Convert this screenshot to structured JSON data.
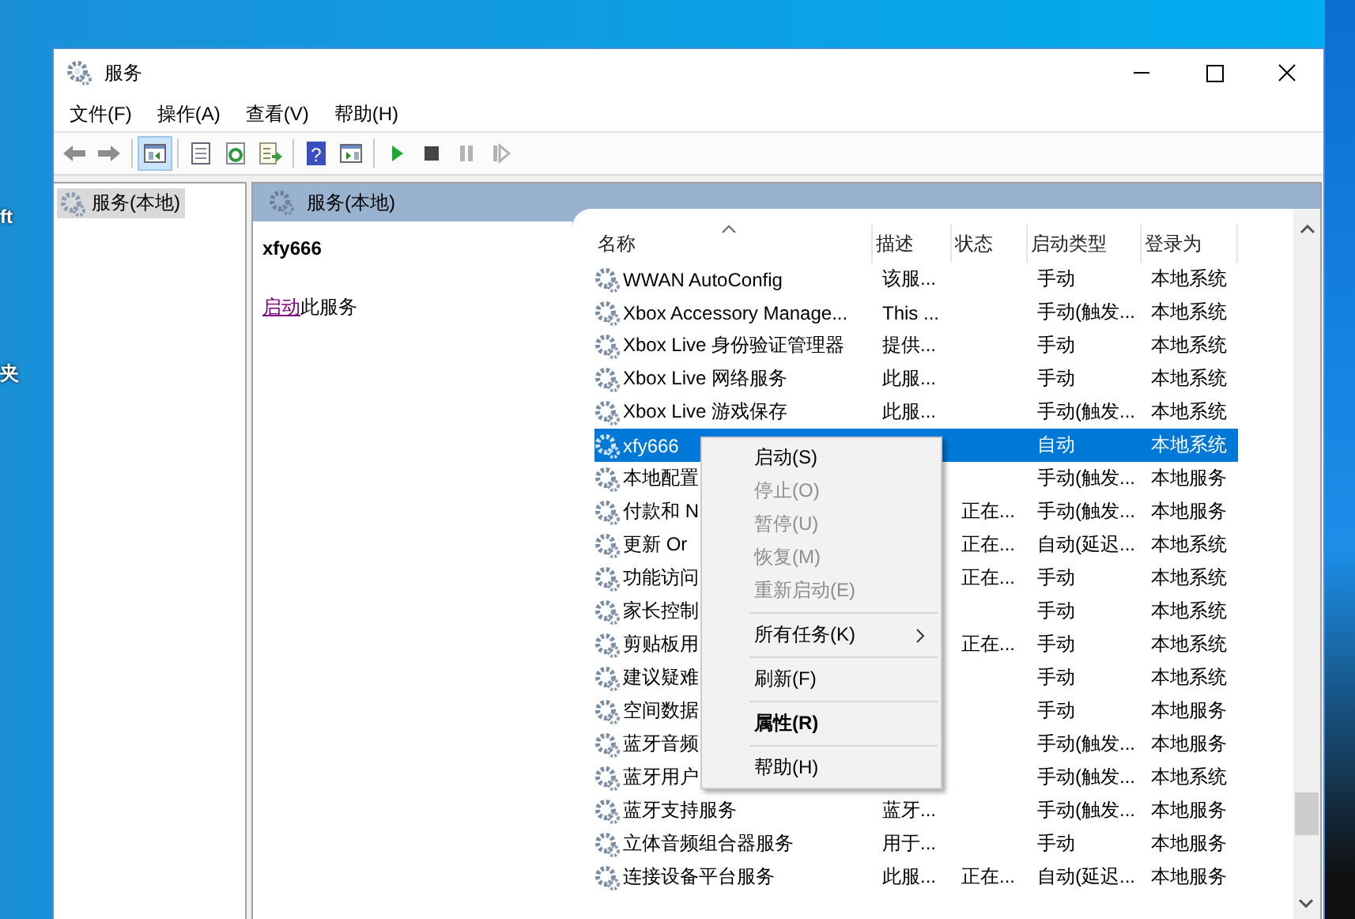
{
  "desktop": {
    "labels": [
      "ft",
      "夹"
    ]
  },
  "window": {
    "title": "服务"
  },
  "menu": [
    "文件(F)",
    "操作(A)",
    "查看(V)",
    "帮助(H)"
  ],
  "toolbar": [
    {
      "kind": "back",
      "disabled": false,
      "pressed": false
    },
    {
      "kind": "forward",
      "disabled": false,
      "pressed": false
    },
    {
      "kind": "sep"
    },
    {
      "kind": "tree",
      "disabled": false,
      "pressed": true
    },
    {
      "kind": "sep"
    },
    {
      "kind": "properties",
      "disabled": false,
      "pressed": false
    },
    {
      "kind": "refresh",
      "disabled": false,
      "pressed": false
    },
    {
      "kind": "export",
      "disabled": false,
      "pressed": false
    },
    {
      "kind": "sep"
    },
    {
      "kind": "help",
      "label": "?",
      "disabled": false,
      "pressed": false
    },
    {
      "kind": "pane",
      "disabled": false,
      "pressed": false
    },
    {
      "kind": "sep"
    },
    {
      "kind": "play",
      "disabled": false,
      "pressed": false
    },
    {
      "kind": "stop",
      "disabled": false,
      "pressed": false
    },
    {
      "kind": "pause",
      "disabled": true,
      "pressed": false
    },
    {
      "kind": "restart",
      "disabled": true,
      "pressed": false
    }
  ],
  "tree": [
    {
      "label": "服务(本地)",
      "selected": true
    }
  ],
  "pane_header": "服务(本地)",
  "detail": {
    "name": "xfy666",
    "link": "启动",
    "text": "此服务"
  },
  "table": {
    "columns": [
      "名称",
      "描述",
      "状态",
      "启动类型",
      "登录为"
    ],
    "rows": [
      {
        "name": "WWAN AutoConfig",
        "desc": "该服...",
        "status": "",
        "startup": "手动",
        "logon": "本地系统",
        "selected": false
      },
      {
        "name": "Xbox Accessory Manage...",
        "desc": "This ...",
        "status": "",
        "startup": "手动(触发...",
        "logon": "本地系统",
        "selected": false
      },
      {
        "name": "Xbox Live 身份验证管理器",
        "desc": "提供...",
        "status": "",
        "startup": "手动",
        "logon": "本地系统",
        "selected": false
      },
      {
        "name": "Xbox Live 网络服务",
        "desc": "此服...",
        "status": "",
        "startup": "手动",
        "logon": "本地系统",
        "selected": false
      },
      {
        "name": "Xbox Live 游戏保存",
        "desc": "此服...",
        "status": "",
        "startup": "手动(触发...",
        "logon": "本地系统",
        "selected": false
      },
      {
        "name": "xfy666",
        "desc": "",
        "status": "",
        "startup": "自动",
        "logon": "本地系统",
        "selected": true
      },
      {
        "name": "本地配置",
        "desc": "",
        "status": "",
        "startup": "手动(触发...",
        "logon": "本地服务",
        "selected": false
      },
      {
        "name": "付款和 N",
        "desc": "",
        "status": "正在...",
        "startup": "手动(触发...",
        "logon": "本地服务",
        "selected": false
      },
      {
        "name": "更新 Or",
        "desc": "",
        "status": "正在...",
        "startup": "自动(延迟...",
        "logon": "本地系统",
        "selected": false
      },
      {
        "name": "功能访问",
        "desc": "",
        "status": "正在...",
        "startup": "手动",
        "logon": "本地系统",
        "selected": false
      },
      {
        "name": "家长控制",
        "desc": "",
        "status": "",
        "startup": "手动",
        "logon": "本地系统",
        "selected": false
      },
      {
        "name": "剪贴板用",
        "desc": "",
        "status": "正在...",
        "startup": "手动",
        "logon": "本地系统",
        "selected": false
      },
      {
        "name": "建议疑难",
        "desc": "",
        "status": "",
        "startup": "手动",
        "logon": "本地系统",
        "selected": false
      },
      {
        "name": "空间数据",
        "desc": "",
        "status": "",
        "startup": "手动",
        "logon": "本地服务",
        "selected": false
      },
      {
        "name": "蓝牙音频",
        "desc": "",
        "status": "",
        "startup": "手动(触发...",
        "logon": "本地服务",
        "selected": false
      },
      {
        "name": "蓝牙用户",
        "desc": "",
        "status": "",
        "startup": "手动(触发...",
        "logon": "本地系统",
        "selected": false
      },
      {
        "name": "蓝牙支持服务",
        "desc": "蓝牙...",
        "status": "",
        "startup": "手动(触发...",
        "logon": "本地服务",
        "selected": false
      },
      {
        "name": "立体音频组合器服务",
        "desc": "用于...",
        "status": "",
        "startup": "手动",
        "logon": "本地服务",
        "selected": false
      },
      {
        "name": "连接设备平台服务",
        "desc": "此服...",
        "status": "正在...",
        "startup": "自动(延迟...",
        "logon": "本地服务",
        "selected": false
      }
    ]
  },
  "context_menu": [
    {
      "kind": "item",
      "label": "启动(S)",
      "disabled": false,
      "bold": false,
      "submenu": false
    },
    {
      "kind": "item",
      "label": "停止(O)",
      "disabled": true,
      "bold": false,
      "submenu": false
    },
    {
      "kind": "item",
      "label": "暂停(U)",
      "disabled": true,
      "bold": false,
      "submenu": false
    },
    {
      "kind": "item",
      "label": "恢复(M)",
      "disabled": true,
      "bold": false,
      "submenu": false
    },
    {
      "kind": "item",
      "label": "重新启动(E)",
      "disabled": true,
      "bold": false,
      "submenu": false
    },
    {
      "kind": "separator"
    },
    {
      "kind": "item",
      "label": "所有任务(K)",
      "disabled": false,
      "bold": false,
      "submenu": true
    },
    {
      "kind": "separator"
    },
    {
      "kind": "item",
      "label": "刷新(F)",
      "disabled": false,
      "bold": false,
      "submenu": false
    },
    {
      "kind": "separator"
    },
    {
      "kind": "item",
      "label": "属性(R)",
      "disabled": false,
      "bold": true,
      "submenu": false
    },
    {
      "kind": "separator"
    },
    {
      "kind": "item",
      "label": "帮助(H)",
      "disabled": false,
      "bold": false,
      "submenu": false
    }
  ]
}
